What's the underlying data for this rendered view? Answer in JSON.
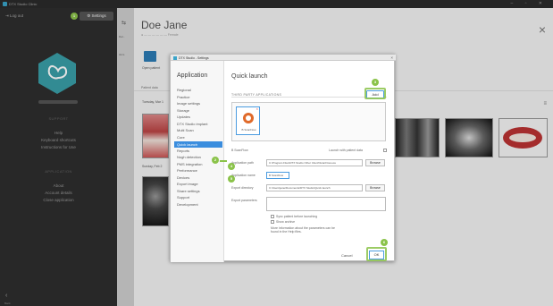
{
  "window": {
    "title": "DTX Studio Clinic",
    "controls": "– ▫ ✕"
  },
  "sidebar": {
    "logout": "⇥ Log out",
    "step_badge": "1",
    "settings_button": "⚙ Settings",
    "sections": [
      {
        "title": "SUPPORT",
        "links": [
          "Help",
          "Keyboard shortcuts",
          "Instructions for Use"
        ]
      },
      {
        "title": "APPLICATION",
        "links": [
          "About",
          "Account details",
          "Close application"
        ]
      }
    ],
    "back_label": "Back"
  },
  "strip": {
    "icon": "⇆",
    "labels": [
      "Dal -",
      "ttrics"
    ]
  },
  "main": {
    "patient_name": "Doe Jane",
    "patient_sub": "● — — — — — —  Female",
    "open_patient": "Open patient",
    "tab_label": "Patient data",
    "date1": "Tuesday, Mar 1",
    "date2": "Sunday, Feb 2",
    "menu_icon": "≡",
    "close_icon": "×"
  },
  "dialog": {
    "title": "DTX Studio - Settings",
    "close": "×",
    "nav": {
      "heading": "Application",
      "items": [
        "Regional",
        "Practice",
        "Image settings",
        "Storage",
        "Updates",
        "DTX Studio implant",
        "Multi Scan",
        "Core",
        "Quick launch",
        "Reports",
        "Nogh detection",
        "PMS integration",
        "Performance",
        "Devices",
        "Export image",
        "Share settings",
        "Support",
        "Development"
      ],
      "selected_index": 8
    },
    "content": {
      "heading": "Quick launch",
      "subheading": "THIRD PARTY APPLICATIONS",
      "add_label": "Add",
      "app_tile_label": "B ScanFlow",
      "app_name_row": "B ScanFlow",
      "launch_with_patient": "Launch with patient data",
      "application_path_label": "Application path",
      "application_path_value": "C:\\Program Files\\DTX Studio Other Client\\ScanFlow.exe",
      "application_name_label": "Application name",
      "application_name_value": "B ScanFlow",
      "export_directory_label": "Export directory",
      "export_directory_value": "C:\\Users\\jane\\Documents\\DTX Studio\\Quick launch",
      "export_parameters_label": "Export parameters",
      "browse_label": "Browse",
      "sync_label": "Sync patient before launching",
      "show_archive_label": "Show archive",
      "info_text": "More information about the parameters can be found in the Help files.",
      "cancel_label": "Cancel",
      "ok_label": "OK"
    },
    "steps": [
      "2",
      "3",
      "4",
      "5",
      "6"
    ]
  }
}
